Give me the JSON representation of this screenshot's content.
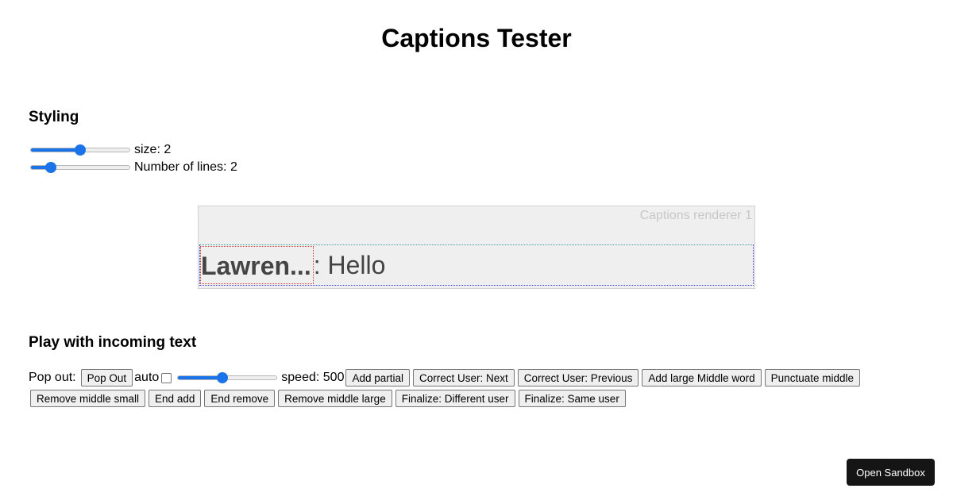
{
  "page": {
    "title": "Captions Tester"
  },
  "styling": {
    "title": "Styling",
    "size": {
      "label": "size: 2",
      "level": 0.5
    },
    "lines": {
      "label": "Number of lines: 2",
      "level": 0.18
    }
  },
  "renderer": {
    "label": "Captions renderer 1",
    "speaker": "Lawren...",
    "text": ": Hello"
  },
  "incoming": {
    "title": "Play with incoming text",
    "pop_out_label": "Pop out:",
    "pop_out_button": "Pop Out",
    "auto_label": "auto",
    "auto_checked": false,
    "speed": {
      "label": "speed: 500",
      "level": 0.45
    },
    "buttons_row1": [
      "Add partial",
      "Correct User: Next",
      "Correct User: Previous",
      "Add large Middle word",
      "Punctuate middle"
    ],
    "buttons_row2": [
      "Remove middle small",
      "End add",
      "End remove",
      "Remove middle large",
      "Finalize: Different user",
      "Finalize: Same user"
    ]
  },
  "sandbox": {
    "label": "Open Sandbox"
  },
  "colors": {
    "accent": "#1a73e8",
    "sandbox_bg": "#151515"
  }
}
